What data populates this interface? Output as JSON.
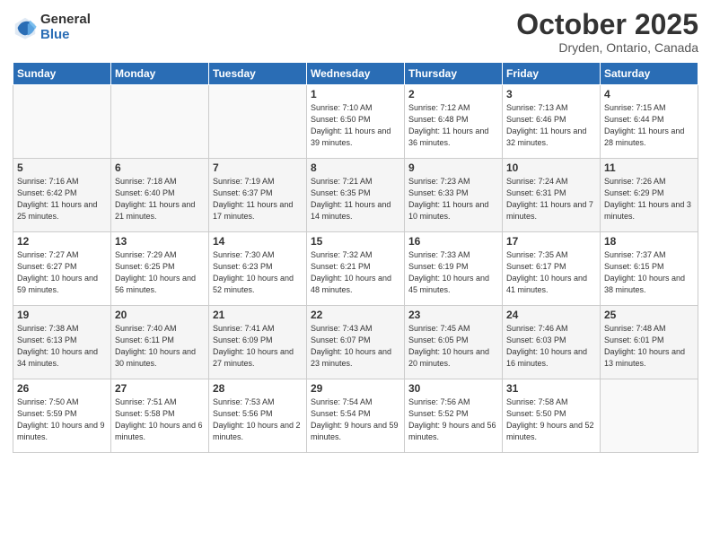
{
  "header": {
    "logo_general": "General",
    "logo_blue": "Blue",
    "month_title": "October 2025",
    "location": "Dryden, Ontario, Canada"
  },
  "days_of_week": [
    "Sunday",
    "Monday",
    "Tuesday",
    "Wednesday",
    "Thursday",
    "Friday",
    "Saturday"
  ],
  "weeks": [
    [
      {
        "day": "",
        "info": ""
      },
      {
        "day": "",
        "info": ""
      },
      {
        "day": "",
        "info": ""
      },
      {
        "day": "1",
        "info": "Sunrise: 7:10 AM\nSunset: 6:50 PM\nDaylight: 11 hours\nand 39 minutes."
      },
      {
        "day": "2",
        "info": "Sunrise: 7:12 AM\nSunset: 6:48 PM\nDaylight: 11 hours\nand 36 minutes."
      },
      {
        "day": "3",
        "info": "Sunrise: 7:13 AM\nSunset: 6:46 PM\nDaylight: 11 hours\nand 32 minutes."
      },
      {
        "day": "4",
        "info": "Sunrise: 7:15 AM\nSunset: 6:44 PM\nDaylight: 11 hours\nand 28 minutes."
      }
    ],
    [
      {
        "day": "5",
        "info": "Sunrise: 7:16 AM\nSunset: 6:42 PM\nDaylight: 11 hours\nand 25 minutes."
      },
      {
        "day": "6",
        "info": "Sunrise: 7:18 AM\nSunset: 6:40 PM\nDaylight: 11 hours\nand 21 minutes."
      },
      {
        "day": "7",
        "info": "Sunrise: 7:19 AM\nSunset: 6:37 PM\nDaylight: 11 hours\nand 17 minutes."
      },
      {
        "day": "8",
        "info": "Sunrise: 7:21 AM\nSunset: 6:35 PM\nDaylight: 11 hours\nand 14 minutes."
      },
      {
        "day": "9",
        "info": "Sunrise: 7:23 AM\nSunset: 6:33 PM\nDaylight: 11 hours\nand 10 minutes."
      },
      {
        "day": "10",
        "info": "Sunrise: 7:24 AM\nSunset: 6:31 PM\nDaylight: 11 hours\nand 7 minutes."
      },
      {
        "day": "11",
        "info": "Sunrise: 7:26 AM\nSunset: 6:29 PM\nDaylight: 11 hours\nand 3 minutes."
      }
    ],
    [
      {
        "day": "12",
        "info": "Sunrise: 7:27 AM\nSunset: 6:27 PM\nDaylight: 10 hours\nand 59 minutes."
      },
      {
        "day": "13",
        "info": "Sunrise: 7:29 AM\nSunset: 6:25 PM\nDaylight: 10 hours\nand 56 minutes."
      },
      {
        "day": "14",
        "info": "Sunrise: 7:30 AM\nSunset: 6:23 PM\nDaylight: 10 hours\nand 52 minutes."
      },
      {
        "day": "15",
        "info": "Sunrise: 7:32 AM\nSunset: 6:21 PM\nDaylight: 10 hours\nand 48 minutes."
      },
      {
        "day": "16",
        "info": "Sunrise: 7:33 AM\nSunset: 6:19 PM\nDaylight: 10 hours\nand 45 minutes."
      },
      {
        "day": "17",
        "info": "Sunrise: 7:35 AM\nSunset: 6:17 PM\nDaylight: 10 hours\nand 41 minutes."
      },
      {
        "day": "18",
        "info": "Sunrise: 7:37 AM\nSunset: 6:15 PM\nDaylight: 10 hours\nand 38 minutes."
      }
    ],
    [
      {
        "day": "19",
        "info": "Sunrise: 7:38 AM\nSunset: 6:13 PM\nDaylight: 10 hours\nand 34 minutes."
      },
      {
        "day": "20",
        "info": "Sunrise: 7:40 AM\nSunset: 6:11 PM\nDaylight: 10 hours\nand 30 minutes."
      },
      {
        "day": "21",
        "info": "Sunrise: 7:41 AM\nSunset: 6:09 PM\nDaylight: 10 hours\nand 27 minutes."
      },
      {
        "day": "22",
        "info": "Sunrise: 7:43 AM\nSunset: 6:07 PM\nDaylight: 10 hours\nand 23 minutes."
      },
      {
        "day": "23",
        "info": "Sunrise: 7:45 AM\nSunset: 6:05 PM\nDaylight: 10 hours\nand 20 minutes."
      },
      {
        "day": "24",
        "info": "Sunrise: 7:46 AM\nSunset: 6:03 PM\nDaylight: 10 hours\nand 16 minutes."
      },
      {
        "day": "25",
        "info": "Sunrise: 7:48 AM\nSunset: 6:01 PM\nDaylight: 10 hours\nand 13 minutes."
      }
    ],
    [
      {
        "day": "26",
        "info": "Sunrise: 7:50 AM\nSunset: 5:59 PM\nDaylight: 10 hours\nand 9 minutes."
      },
      {
        "day": "27",
        "info": "Sunrise: 7:51 AM\nSunset: 5:58 PM\nDaylight: 10 hours\nand 6 minutes."
      },
      {
        "day": "28",
        "info": "Sunrise: 7:53 AM\nSunset: 5:56 PM\nDaylight: 10 hours\nand 2 minutes."
      },
      {
        "day": "29",
        "info": "Sunrise: 7:54 AM\nSunset: 5:54 PM\nDaylight: 9 hours\nand 59 minutes."
      },
      {
        "day": "30",
        "info": "Sunrise: 7:56 AM\nSunset: 5:52 PM\nDaylight: 9 hours\nand 56 minutes."
      },
      {
        "day": "31",
        "info": "Sunrise: 7:58 AM\nSunset: 5:50 PM\nDaylight: 9 hours\nand 52 minutes."
      },
      {
        "day": "",
        "info": ""
      }
    ]
  ]
}
